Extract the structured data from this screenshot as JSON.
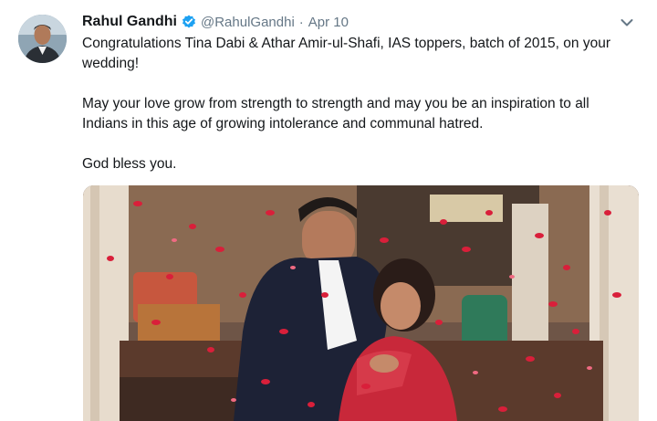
{
  "tweet": {
    "author_name": "Rahul Gandhi",
    "handle": "@RahulGandhi",
    "separator": "·",
    "date": "Apr 10",
    "paragraphs": [
      "Congratulations Tina Dabi & Athar Amir-ul-Shafi, IAS toppers, batch of 2015, on your wedding!",
      "May your love grow from strength to strength and may you be an inspiration to all Indians in this age of growing intolerance and communal hatred.",
      "God bless you."
    ],
    "icons": {
      "verified": "verified-badge-icon",
      "menu": "chevron-down-icon"
    },
    "colors": {
      "verified_blue": "#1da1f2",
      "secondary_text": "#657786",
      "primary_text": "#14171a",
      "petal_red": "#c8102e"
    }
  }
}
